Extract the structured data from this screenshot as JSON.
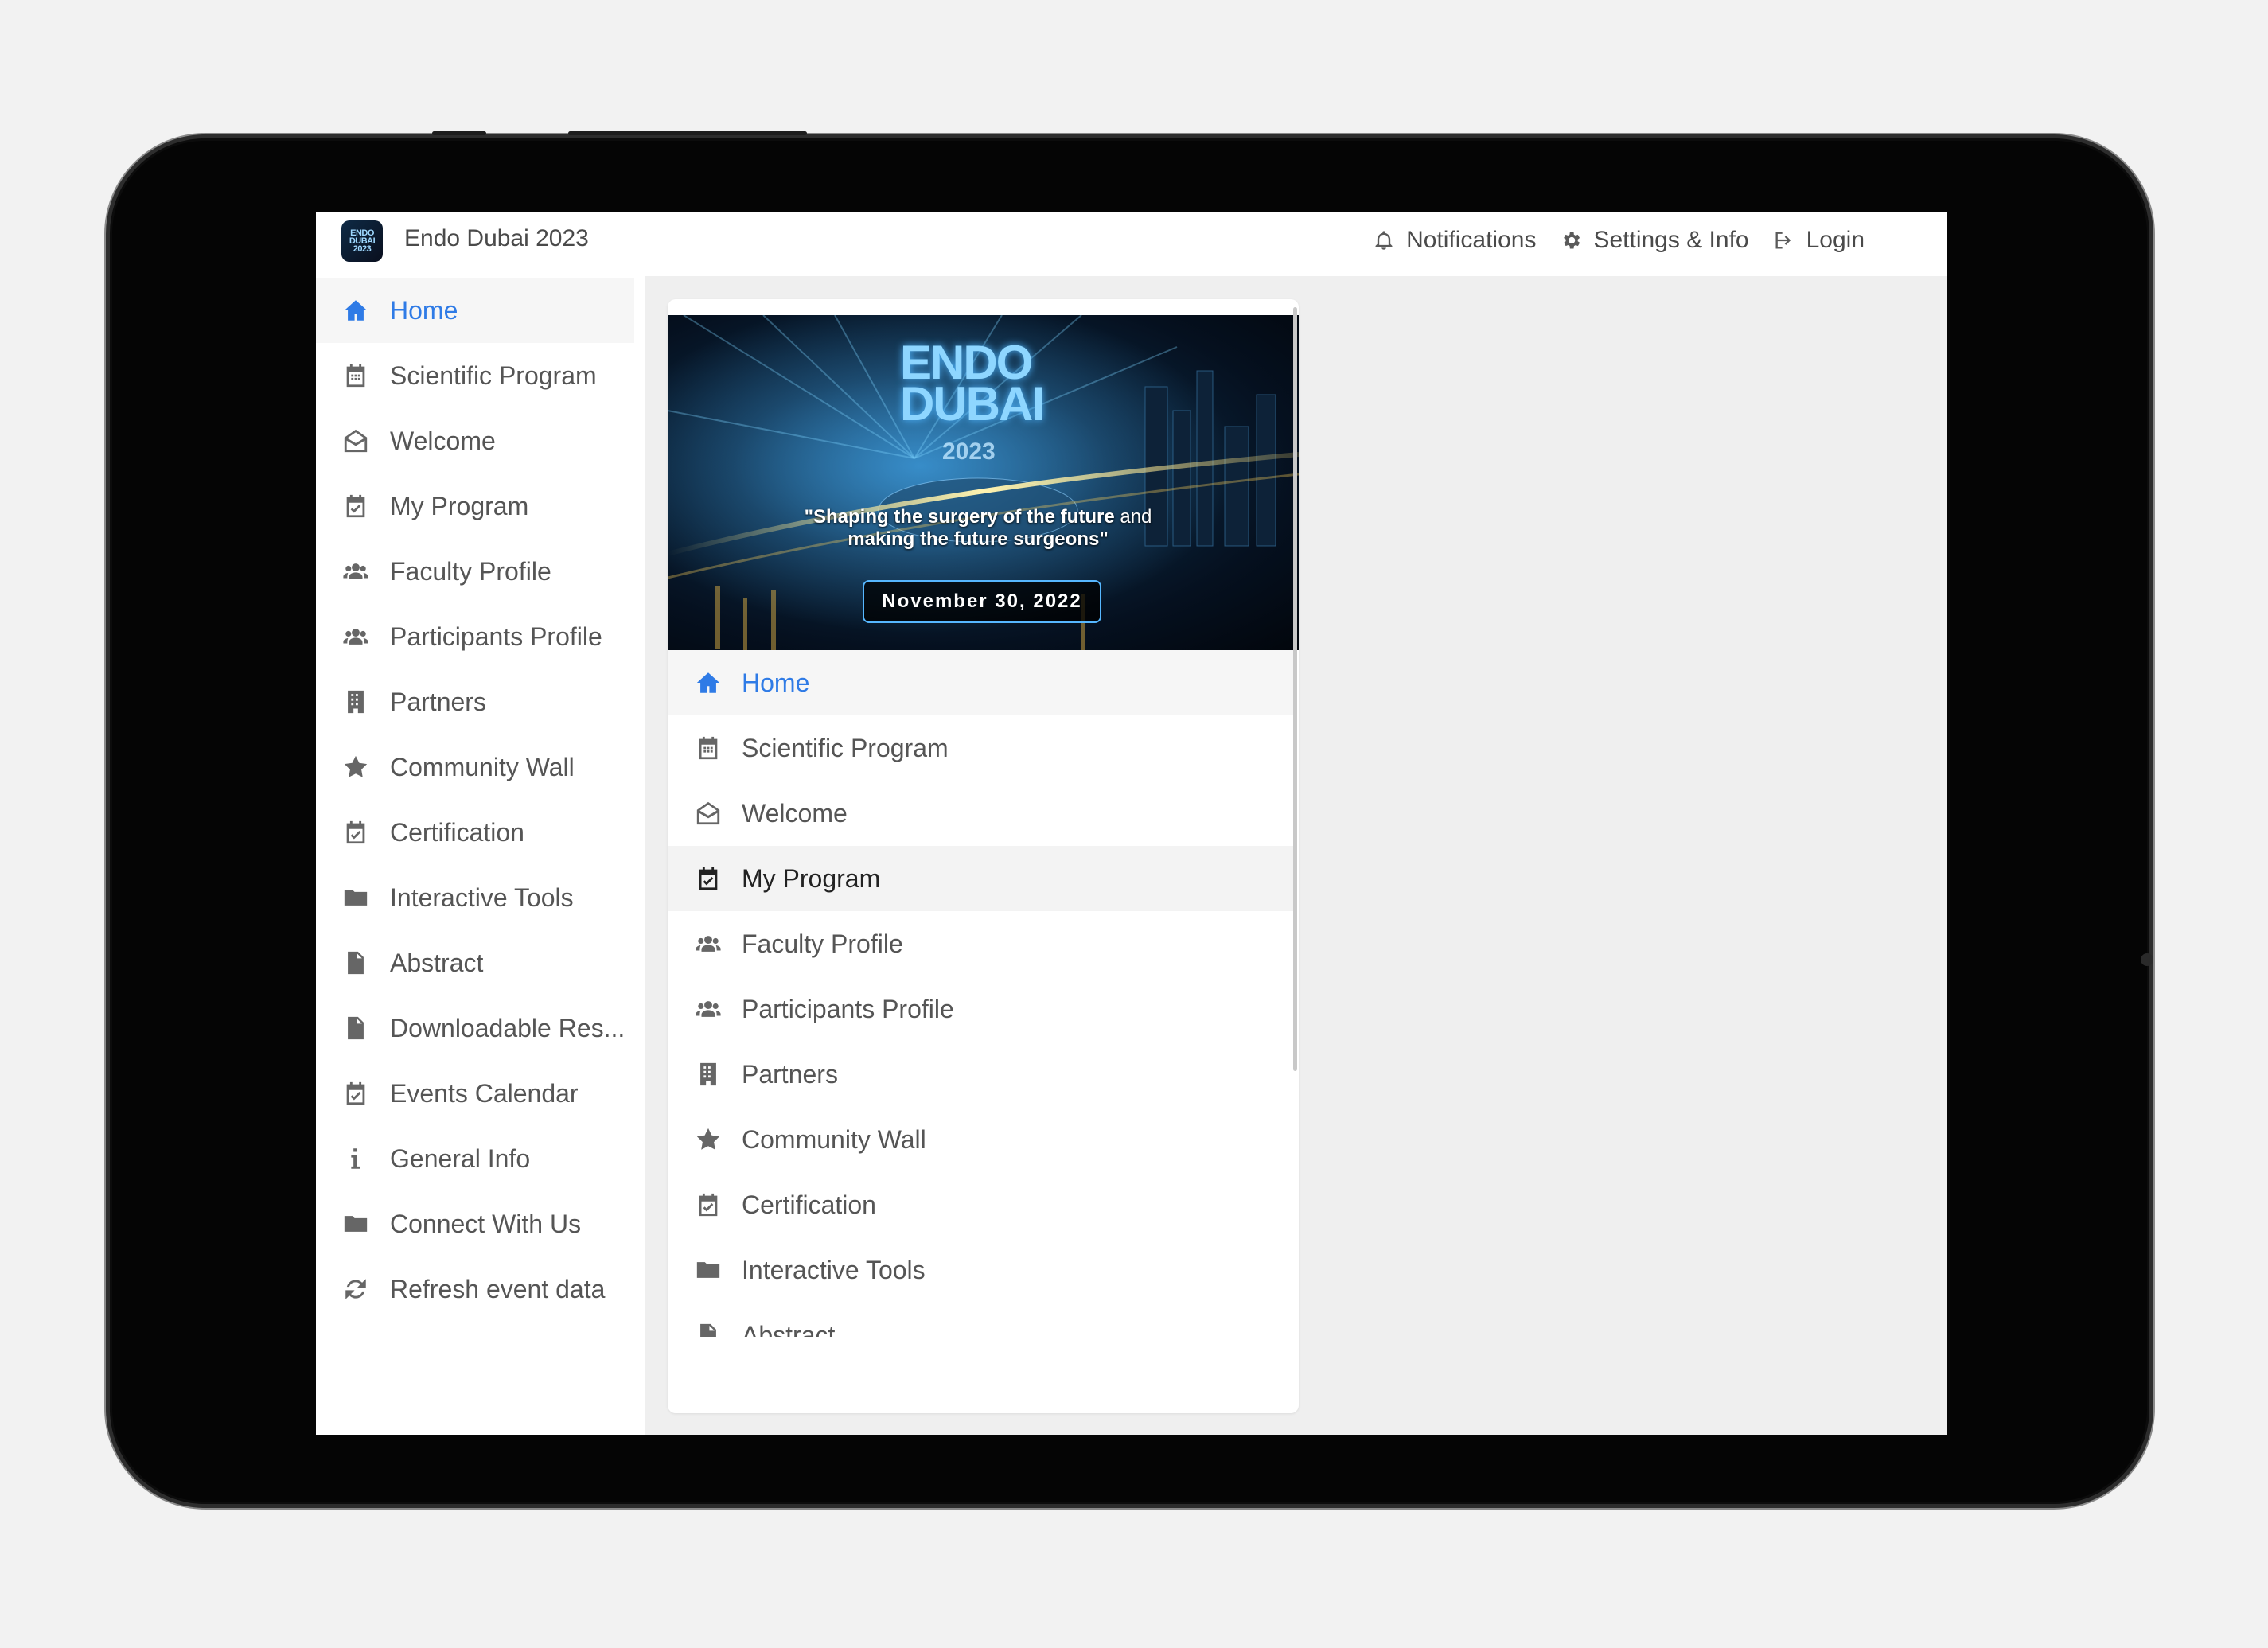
{
  "app": {
    "title": "Endo Dubai 2023",
    "logo_text": "ENDO DUBAI 2023"
  },
  "topbar": {
    "notifications_label": "Notifications",
    "settings_label": "Settings & Info",
    "login_label": "Login"
  },
  "colors": {
    "accent": "#2f7be6",
    "text": "#555555",
    "background": "#efefef"
  },
  "sidebar": {
    "items": [
      {
        "label": "Home",
        "icon": "home-icon",
        "active": true
      },
      {
        "label": "Scientific Program",
        "icon": "calendar-icon"
      },
      {
        "label": "Welcome",
        "icon": "envelope-open-icon"
      },
      {
        "label": "My Program",
        "icon": "calendar-check-icon"
      },
      {
        "label": "Faculty Profile",
        "icon": "users-icon"
      },
      {
        "label": "Participants Profile",
        "icon": "users-icon"
      },
      {
        "label": "Partners",
        "icon": "building-icon"
      },
      {
        "label": "Community Wall",
        "icon": "star-icon"
      },
      {
        "label": "Certification",
        "icon": "calendar-check-icon"
      },
      {
        "label": "Interactive Tools",
        "icon": "folder-icon"
      },
      {
        "label": "Abstract",
        "icon": "file-icon"
      },
      {
        "label": "Downloadable Res...",
        "icon": "file-icon"
      },
      {
        "label": "Events Calendar",
        "icon": "calendar-check-icon"
      },
      {
        "label": "General Info",
        "icon": "info-icon"
      },
      {
        "label": "Connect With Us",
        "icon": "folder-icon"
      },
      {
        "label": "Refresh event data",
        "icon": "refresh-icon"
      }
    ]
  },
  "banner": {
    "logo_line1": "ENDO",
    "logo_line2": "DUBAI",
    "year": "2023",
    "tagline_bold_1": "\"Shaping the surgery of the future",
    "tagline_normal": " and",
    "tagline_bold_2": "making the future surgeons\"",
    "date": "November 30, 2022"
  },
  "card_menu": {
    "items": [
      {
        "label": "Home",
        "icon": "home-icon",
        "active": true
      },
      {
        "label": "Scientific Program",
        "icon": "calendar-icon"
      },
      {
        "label": "Welcome",
        "icon": "envelope-open-icon"
      },
      {
        "label": "My Program",
        "icon": "calendar-check-icon",
        "hover": true
      },
      {
        "label": "Faculty Profile",
        "icon": "users-icon"
      },
      {
        "label": "Participants Profile",
        "icon": "users-icon"
      },
      {
        "label": "Partners",
        "icon": "building-icon"
      },
      {
        "label": "Community Wall",
        "icon": "star-icon"
      },
      {
        "label": "Certification",
        "icon": "calendar-check-icon"
      },
      {
        "label": "Interactive Tools",
        "icon": "folder-icon"
      },
      {
        "label": "Abstract",
        "icon": "file-icon"
      }
    ]
  }
}
